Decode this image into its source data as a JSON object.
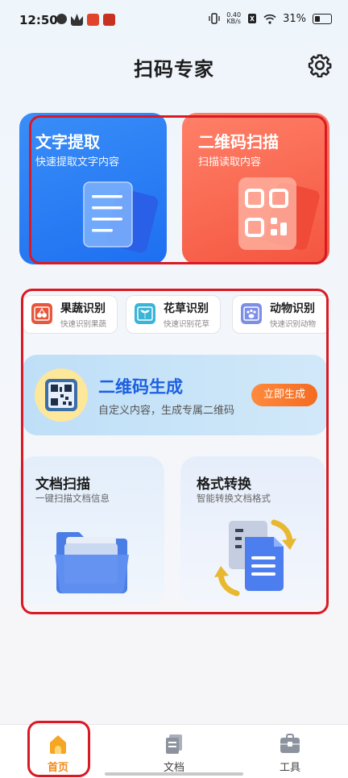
{
  "status_bar": {
    "time": "12:50",
    "net_speed_value": "0.40",
    "net_speed_unit": "KB/s",
    "battery": "31%"
  },
  "header": {
    "title": "扫码专家",
    "settings_icon": "gear-icon"
  },
  "top_cards": [
    {
      "title": "文字提取",
      "subtitle": "快速提取文字内容",
      "icon": "document-icon",
      "color": "#2b7ff3"
    },
    {
      "title": "二维码扫描",
      "subtitle": "扫描读取内容",
      "icon": "qr-code-icon",
      "color": "#f66a52"
    }
  ],
  "chips": [
    {
      "name": "果蔬识别",
      "desc": "快速识别果蔬",
      "icon": "cherry-icon"
    },
    {
      "name": "花草识别",
      "desc": "快速识别花草",
      "icon": "plant-icon"
    },
    {
      "name": "动物识别",
      "desc": "快速识别动物",
      "icon": "paw-icon"
    }
  ],
  "qr_banner": {
    "title": "二维码生成",
    "subtitle": "自定义内容，生成专属二维码",
    "button": "立即生成"
  },
  "bottom_cards": [
    {
      "title": "文档扫描",
      "subtitle": "一键扫描文档信息",
      "icon": "folder-icon"
    },
    {
      "title": "格式转换",
      "subtitle": "智能转换文档格式",
      "icon": "convert-document-icon"
    }
  ],
  "nav": [
    {
      "label": "首页",
      "icon": "home-icon",
      "active": true
    },
    {
      "label": "文档",
      "icon": "document-stack-icon",
      "active": false
    },
    {
      "label": "工具",
      "icon": "toolbox-icon",
      "active": false
    }
  ],
  "colors": {
    "accent": "#2b7ff3",
    "highlight_outline": "#d91a24",
    "active_nav": "#f5a623"
  }
}
